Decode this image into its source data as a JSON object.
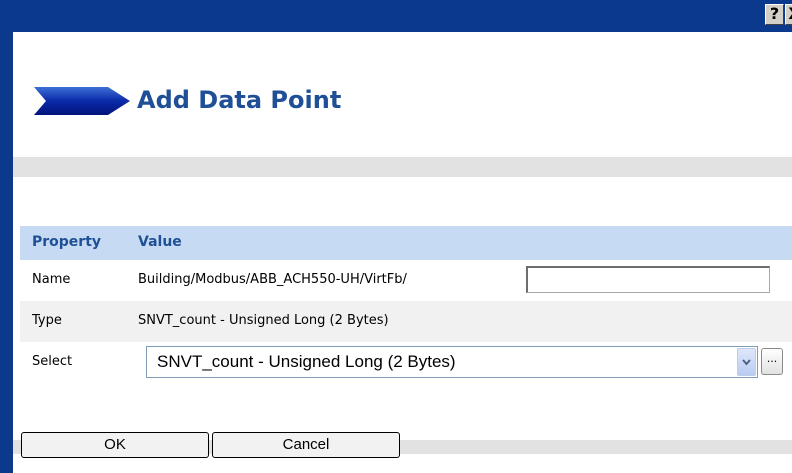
{
  "titlebar": {
    "help_label": "?",
    "close_label": "X"
  },
  "header": {
    "title": "Add Data Point",
    "arrow_icon": "chevron-arrow-icon"
  },
  "table": {
    "columns": [
      "Property",
      "Value"
    ],
    "rows": [
      {
        "label": "Name",
        "value": "Building/Modbus/ABB_ACH550-UH/VirtFb/",
        "input_value": ""
      },
      {
        "label": "Type",
        "value": "SNVT_count - Unsigned Long (2 Bytes)"
      },
      {
        "label": "Select",
        "selected": "SNVT_count - Unsigned Long (2 Bytes)",
        "browse_label": "..."
      }
    ]
  },
  "buttons": {
    "ok": "OK",
    "cancel": "Cancel"
  },
  "colors": {
    "titlebar": "#0b3a8c",
    "title": "#1f4f96",
    "header_bg": "#c6dbf3"
  }
}
